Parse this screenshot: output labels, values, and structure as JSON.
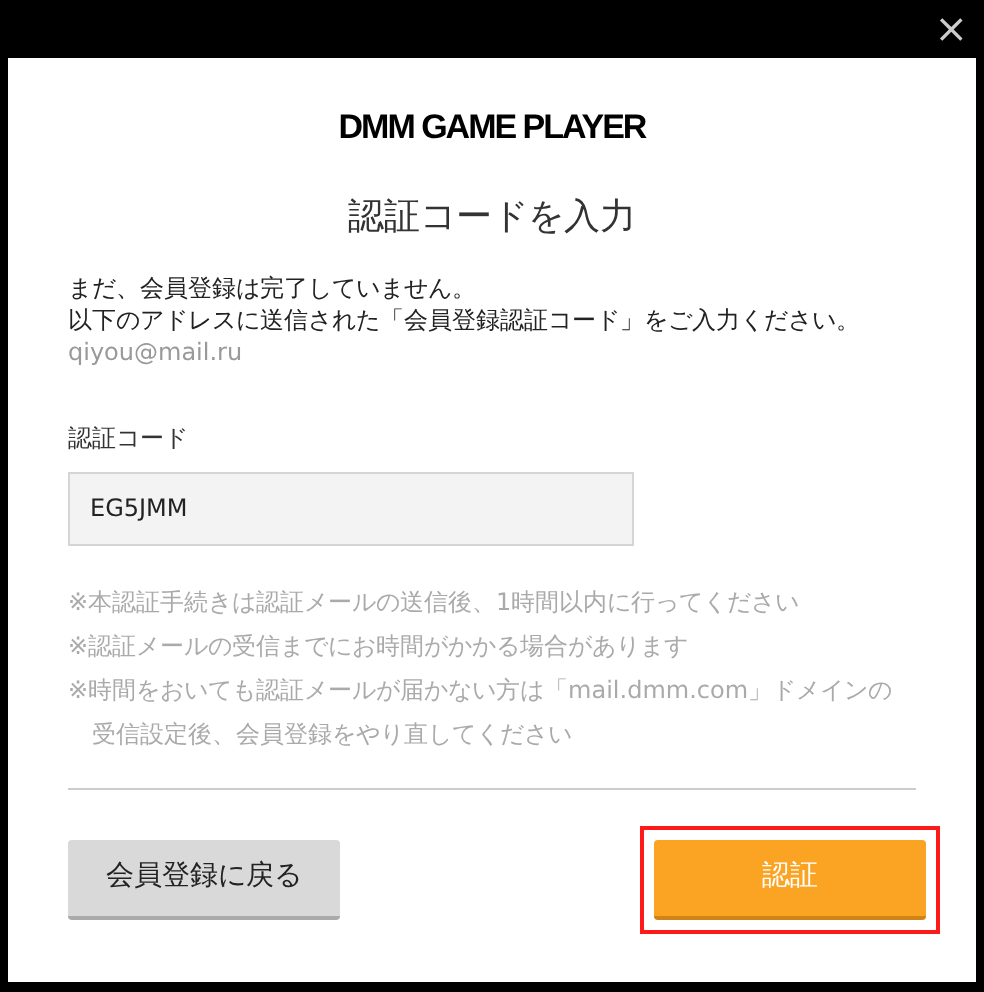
{
  "window": {
    "close": "×"
  },
  "logo": "DMM GAME PLAYER",
  "title": "認証コードを入力",
  "message": [
    "まだ、会員登録は完了していません。",
    "以下のアドレスに送信された「会員登録認証コード」をご入力ください。"
  ],
  "email": "qiyou@mail.ru",
  "code_field": {
    "label": "認証コード",
    "value": "EG5JMM"
  },
  "notes": [
    "※本認証手続きは認証メールの送信後、1時間以内に行ってください",
    "※認証メールの受信までにお時間がかかる場合があります",
    "※時間をおいても認証メールが届かない方は「mail.dmm.com」ドメインの受信設定後、会員登録をやり直してください"
  ],
  "buttons": [
    {
      "label": "会員登録に戻る",
      "kind": "secondary",
      "highlighted": false
    },
    {
      "label": "認証",
      "kind": "primary",
      "highlighted": true
    }
  ]
}
